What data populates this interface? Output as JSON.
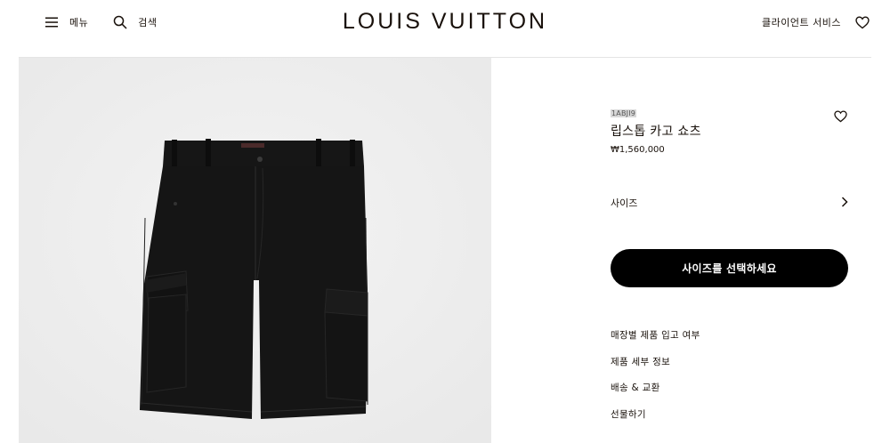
{
  "header": {
    "menu_label": "메뉴",
    "search_label": "검색",
    "logo": "LOUIS VUITTON",
    "client_services_label": "클라이언트 서비스"
  },
  "product": {
    "sku": "1ABJI9",
    "name": "립스톱 카고 쇼츠",
    "price": "₩1,560,000",
    "size_label": "사이즈",
    "cta_label": "사이즈를 선택하세요",
    "links": [
      "매장별 제품 입고 여부",
      "제품 세부 정보",
      "배송 & 교환",
      "선물하기"
    ]
  },
  "colors": {
    "text": "#19110b",
    "image_background": "#efefef",
    "cta_background": "#000000",
    "product_fabric": "#151515"
  },
  "icons": {
    "menu": "hamburger-icon",
    "search": "search-icon",
    "wishlist": "heart-icon",
    "size_chevron": "chevron-right-icon"
  }
}
